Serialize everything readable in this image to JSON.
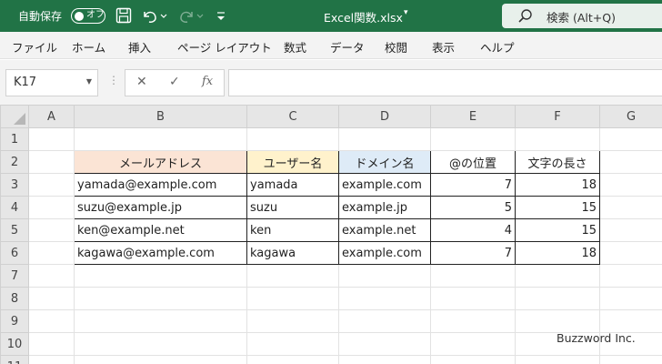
{
  "titlebar": {
    "autosave_label": "自動保存",
    "toggle_text": "オフ",
    "filename": "Excel関数.xlsx",
    "search_placeholder": "検索 (Alt+Q)",
    "bg_color": "#217346"
  },
  "menu": [
    "ファイル",
    "ホーム",
    "挿入",
    "ページ レイアウト",
    "数式",
    "データ",
    "校閲",
    "表示",
    "ヘルプ"
  ],
  "formula_bar": {
    "name_box": "K17",
    "cancel_icon": "✕",
    "enter_icon": "✓",
    "fx_icon": "fx",
    "formula": ""
  },
  "columns": [
    "A",
    "B",
    "C",
    "D",
    "E",
    "F",
    "G"
  ],
  "rows": [
    "1",
    "2",
    "3",
    "4",
    "5",
    "6",
    "7",
    "8",
    "9",
    "10",
    "11"
  ],
  "table": {
    "headers": [
      "メールアドレス",
      "ユーザー名",
      "ドメイン名",
      "@の位置",
      "文字の長さ"
    ],
    "header_colors": [
      "#fbe4d5",
      "#fff2cc",
      "#deebf7",
      "#ffffff",
      "#ffffff"
    ],
    "data": [
      [
        "yamada@example.com",
        "yamada",
        "example.com",
        "7",
        "18"
      ],
      [
        "suzu@example.jp",
        "suzu",
        "example.jp",
        "5",
        "15"
      ],
      [
        "ken@example.net",
        "ken",
        "example.net",
        "4",
        "15"
      ],
      [
        "kagawa@example.com",
        "kagawa",
        "example.com",
        "7",
        "18"
      ]
    ]
  },
  "watermark": "Buzzword Inc."
}
